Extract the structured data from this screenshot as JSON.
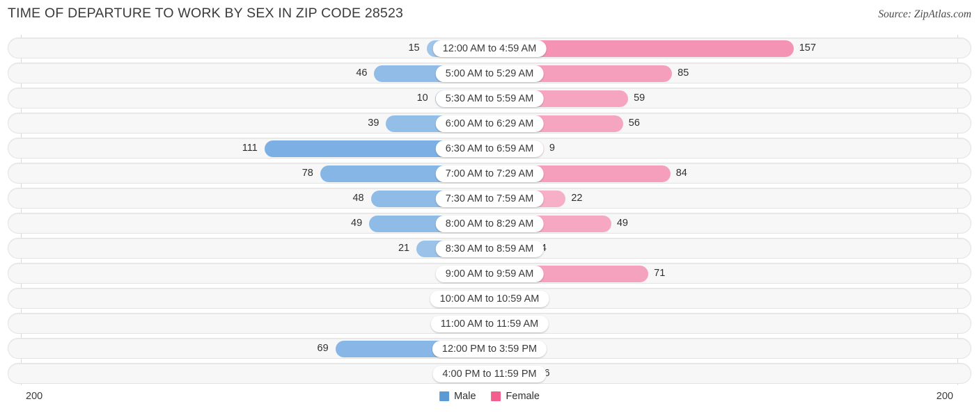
{
  "header": {
    "title": "TIME OF DEPARTURE TO WORK BY SEX IN ZIP CODE 28523",
    "source": "Source: ZipAtlas.com"
  },
  "legend": {
    "male_label": "Male",
    "female_label": "Female",
    "male_color": "#5b9bd5",
    "female_color": "#f25e8d"
  },
  "axis": {
    "left_tick": "200",
    "right_tick": "200",
    "max": 200
  },
  "chart_data": {
    "type": "bar",
    "title": "TIME OF DEPARTURE TO WORK BY SEX IN ZIP CODE 28523",
    "subtitle": "Source: ZipAtlas.com",
    "orientation": "horizontal",
    "style": "diverging-butterfly",
    "xlabel": "",
    "ylabel": "",
    "xlim": [
      200,
      200
    ],
    "grid": false,
    "legend_position": "bottom-center",
    "categories": [
      "12:00 AM to 4:59 AM",
      "5:00 AM to 5:29 AM",
      "5:30 AM to 5:59 AM",
      "6:00 AM to 6:29 AM",
      "6:30 AM to 6:59 AM",
      "7:00 AM to 7:29 AM",
      "7:30 AM to 7:59 AM",
      "8:00 AM to 8:29 AM",
      "8:30 AM to 8:59 AM",
      "9:00 AM to 9:59 AM",
      "10:00 AM to 10:59 AM",
      "11:00 AM to 11:59 AM",
      "12:00 PM to 3:59 PM",
      "4:00 PM to 11:59 PM"
    ],
    "series": [
      {
        "name": "Male",
        "color": "#5b9bd5",
        "side": "left",
        "values": [
          15,
          46,
          10,
          39,
          111,
          78,
          48,
          49,
          21,
          2,
          0,
          0,
          69,
          1
        ]
      },
      {
        "name": "Female",
        "color": "#f25e8d",
        "side": "right",
        "values": [
          157,
          85,
          59,
          56,
          9,
          84,
          22,
          49,
          4,
          71,
          1,
          0,
          0,
          6
        ]
      }
    ]
  },
  "rows": [
    {
      "label": "12:00 AM to 4:59 AM",
      "male": "15",
      "female": "157"
    },
    {
      "label": "5:00 AM to 5:29 AM",
      "male": "46",
      "female": "85"
    },
    {
      "label": "5:30 AM to 5:59 AM",
      "male": "10",
      "female": "59"
    },
    {
      "label": "6:00 AM to 6:29 AM",
      "male": "39",
      "female": "56"
    },
    {
      "label": "6:30 AM to 6:59 AM",
      "male": "111",
      "female": "9"
    },
    {
      "label": "7:00 AM to 7:29 AM",
      "male": "78",
      "female": "84"
    },
    {
      "label": "7:30 AM to 7:59 AM",
      "male": "48",
      "female": "22"
    },
    {
      "label": "8:00 AM to 8:29 AM",
      "male": "49",
      "female": "49"
    },
    {
      "label": "8:30 AM to 8:59 AM",
      "male": "21",
      "female": "4"
    },
    {
      "label": "9:00 AM to 9:59 AM",
      "male": "2",
      "female": "71"
    },
    {
      "label": "10:00 AM to 10:59 AM",
      "male": "0",
      "female": "1"
    },
    {
      "label": "11:00 AM to 11:59 AM",
      "male": "0",
      "female": "0"
    },
    {
      "label": "12:00 PM to 3:59 PM",
      "male": "69",
      "female": "0"
    },
    {
      "label": "4:00 PM to 11:59 PM",
      "male": "1",
      "female": "6"
    }
  ]
}
